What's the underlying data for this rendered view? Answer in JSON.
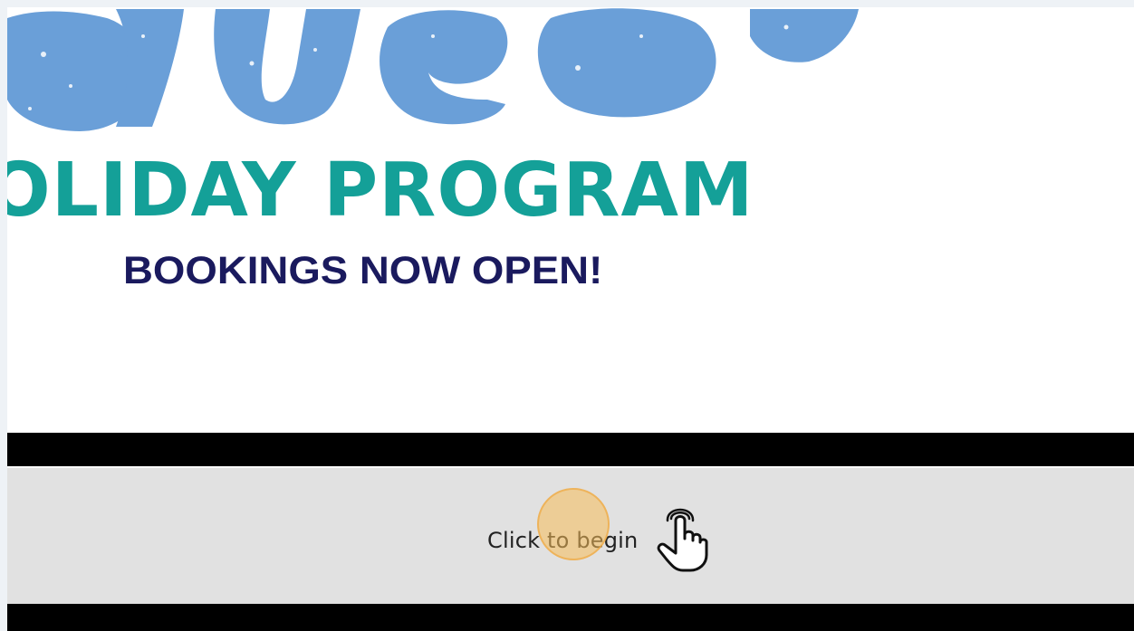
{
  "banner": {
    "title": "OLIDAY PROGRAM",
    "subtitle": "BOOKINGS NOW OPEN!",
    "script_color": "#6a9fd8",
    "title_color": "#14a098",
    "subtitle_color": "#1a1a5e"
  },
  "start": {
    "label": "Click to begin",
    "icon": "pointing-hand-icon",
    "panel_color": "#e1e1e1"
  },
  "click_indicator": {
    "color": "#f7be5a"
  }
}
